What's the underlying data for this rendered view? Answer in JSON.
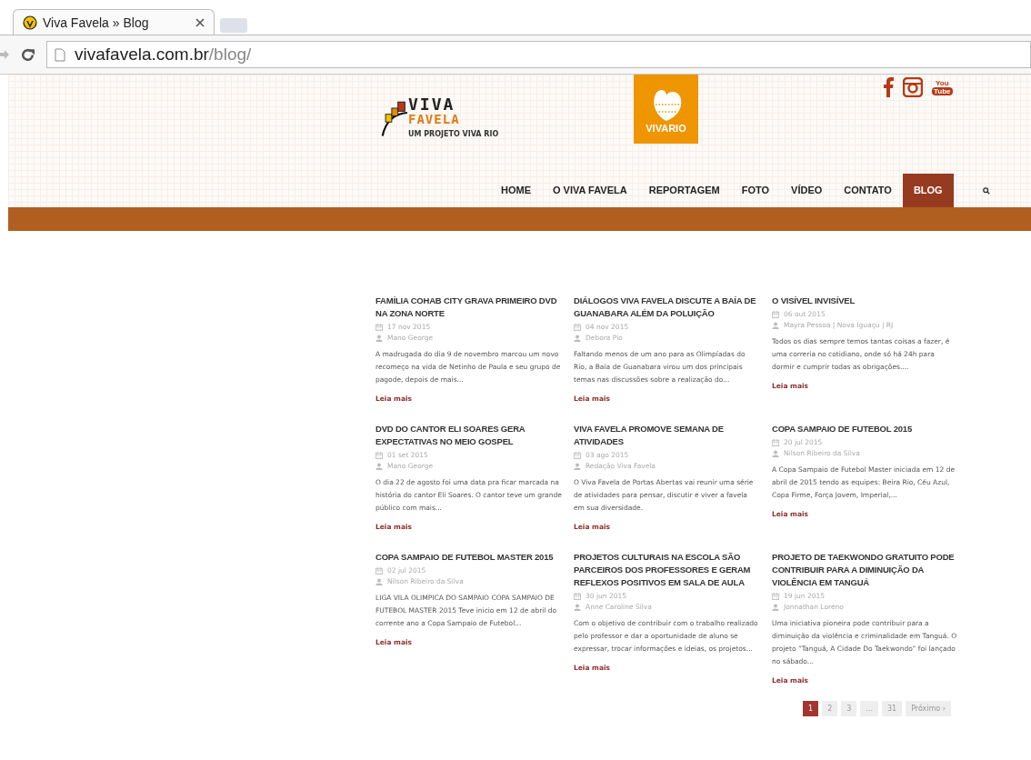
{
  "browser": {
    "tabs": [
      {
        "title": "Viva Favela » Blog",
        "selected": true
      }
    ],
    "url_host": "vivafavela.com.br",
    "url_path": "/blog/"
  },
  "header": {
    "logo": {
      "line1": "VIVA",
      "line2": "FAVELA",
      "tagline": "UM PROJETO VIVA RIO"
    },
    "partner": "VIVARIO",
    "social": [
      {
        "kind": "facebook"
      },
      {
        "kind": "instagram"
      },
      {
        "kind": "youtube",
        "top": "You",
        "bottom": "Tube"
      }
    ],
    "nav": [
      {
        "label": "HOME",
        "selected": false
      },
      {
        "label": "O VIVA FAVELA",
        "selected": false
      },
      {
        "label": "REPORTAGEM",
        "selected": false
      },
      {
        "label": "FOTO",
        "selected": false
      },
      {
        "label": "VÍDEO",
        "selected": false
      },
      {
        "label": "CONTATO",
        "selected": false
      },
      {
        "label": "BLOG",
        "selected": true
      }
    ]
  },
  "posts": [
    {
      "title": "FAMÍLIA COHAB CITY GRAVA PRIMEIRO DVD NA ZONA NORTE",
      "date": "17 nov 2015",
      "author": "Mano George",
      "excerpt": "A madrugada do dia 9 de novembro marcou um novo recomeço na vida de Netinho de Paula e seu grupo de pagode, depois de mais...",
      "more": "Leia mais"
    },
    {
      "title": "DIÁLOGOS VIVA FAVELA DISCUTE A BAÍA DE GUANABARA ALÉM DA POLUIÇÃO",
      "date": "04 nov 2015",
      "author": "Debora Pio",
      "excerpt": "Faltando menos de um ano para as Olimpíadas do Rio, a Baía de Guanabara virou um dos principais temas nas discussões sobre a realização do...",
      "more": "Leia mais"
    },
    {
      "title": "O VISÍVEL INVISÍVEL",
      "date": "06 out 2015",
      "author": "Mayra Pessoa | Nova Iguaçu | RJ",
      "excerpt": "Todos os dias sempre temos tantas coisas a fazer, é uma correria no cotidiano, onde só há 24h para dormir e cumprir todas as obrigações....",
      "more": "Leia mais"
    },
    {
      "title": "DVD DO CANTOR ELI SOARES GERA EXPECTATIVAS NO MEIO GOSPEL",
      "date": "01 set 2015",
      "author": "Mano George",
      "excerpt": "O dia 22 de agosto foi uma data pra ficar marcada na história do cantor Eli Soares. O cantor teve um grande público com mais...",
      "more": "Leia mais"
    },
    {
      "title": "VIVA FAVELA PROMOVE SEMANA DE ATIVIDADES",
      "date": "03 ago 2015",
      "author": "Redação Viva Favela",
      "excerpt": "O Viva Favela de Portas Abertas vai reunir uma série de atividades para pensar, discutir e viver a favela em sua diversidade.",
      "more": "Leia mais"
    },
    {
      "title": "COPA SAMPAIO DE FUTEBOL 2015",
      "date": "20 jul 2015",
      "author": "Nilson Ribeiro da Silva",
      "excerpt": "A Copa Sampaio de Futebol Master iniciada em 12 de abril de 2015 tendo as equipes: Beira Rio, Céu Azul, Copa Firme, Força Jovem, Imperial,...",
      "more": "Leia mais"
    },
    {
      "title": "COPA SAMPAIO DE FUTEBOL MASTER 2015",
      "date": "02 jul 2015",
      "author": "Nilson Ribeiro da Silva",
      "excerpt": "LIGA VILA OLIMPICA DO SAMPAIO COPA SAMPAIO DE FUTEBOL MASTER 2015 Teve inicio em 12 de abril do corrente ano a Copa Sampaio de Futebol...",
      "more": "Leia mais"
    },
    {
      "title": "PROJETOS CULTURAIS NA ESCOLA SÃO PARCEIROS DOS PROFESSORES E GERAM REFLEXOS POSITIVOS EM SALA DE AULA",
      "date": "30 jun 2015",
      "author": "Anne Caroline Silva",
      "excerpt": "Com o objetivo de contribuir com o trabalho realizado pelo professor e dar a oportunidade de aluno se expressar, trocar informações e ideias, os projetos...",
      "more": "Leia mais"
    },
    {
      "title": "PROJETO DE TAEKWONDO GRATUITO PODE CONTRIBUIR PARA A DIMINUIÇÃO DA VIOLÊNCIA EM TANGUÁ",
      "date": "19 jun 2015",
      "author": "Jonnathan Loreno",
      "excerpt": "Uma iniciativa pioneira pode contribuir para a diminuição da violência e criminalidade em Tanguá. O projeto “Tanguá, A Cidade Do Taekwondo” foi lançado no sábado...",
      "more": "Leia mais"
    }
  ],
  "pagination": [
    {
      "label": "1",
      "selected": true
    },
    {
      "label": "2",
      "selected": false
    },
    {
      "label": "3",
      "selected": false
    },
    {
      "label": "...",
      "selected": false
    },
    {
      "label": "31",
      "selected": false
    },
    {
      "label": "Próximo ›",
      "selected": false
    }
  ]
}
